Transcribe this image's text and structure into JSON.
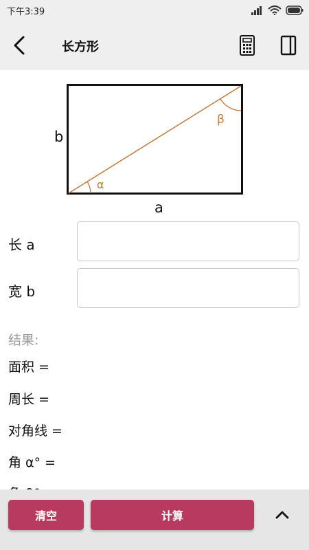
{
  "status": {
    "time": "下午3:39"
  },
  "header": {
    "title": "长方形"
  },
  "diagram": {
    "label_a": "a",
    "label_b": "b",
    "angle_alpha": "α",
    "angle_beta": "β"
  },
  "inputs": {
    "length_label": "长  a",
    "width_label": "宽  b",
    "length_value": "",
    "width_value": ""
  },
  "results": {
    "header": "结果:",
    "area": "面积 =",
    "perimeter": "周长 =",
    "diagonal": "对角线 =",
    "angle_alpha": "角  α° =",
    "angle_beta": "角  β°"
  },
  "buttons": {
    "clear": "清空",
    "calculate": "计算"
  },
  "colors": {
    "accent": "#b83a60",
    "diagonal_line": "#c07a3e",
    "bar_bg": "#efefef"
  }
}
